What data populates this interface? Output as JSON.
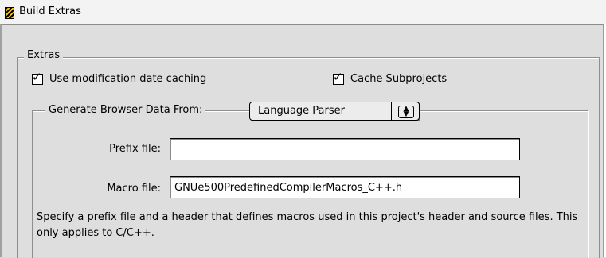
{
  "window": {
    "title": "Build Extras"
  },
  "extras": {
    "group_label": "Extras",
    "use_mod_date": {
      "label": "Use modification date caching",
      "checked": true
    },
    "cache_subprojects": {
      "label": "Cache Subprojects",
      "checked": true
    }
  },
  "browser": {
    "label": "Generate Browser Data From:",
    "selected": "Language Parser"
  },
  "fields": {
    "prefix_label": "Prefix file:",
    "prefix_value": "",
    "macro_label": "Macro file:",
    "macro_value": "GNUe500PredefinedCompilerMacros_C++.h"
  },
  "help": "Specify a prefix file and a header that defines macros used in this project's header and source files.  This only applies to C/C++."
}
